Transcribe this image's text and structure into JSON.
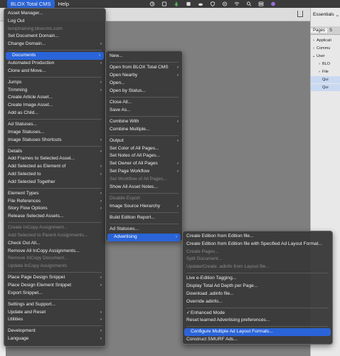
{
  "menubar": {
    "items": [
      "BLOX Total CMS",
      "Help"
    ]
  },
  "panel": {
    "workspace": "Essentials",
    "tabs": [
      "Pages",
      "S"
    ],
    "tree": [
      "Applicati",
      "Commu",
      "User",
      "BLO",
      "File",
      "Qui",
      "Qui"
    ]
  },
  "main_menu": [
    {
      "label": "Asset Manager...",
      "disabled": false
    },
    {
      "label": "Log Out",
      "disabled": false
    },
    {
      "label": "temptraining.bloxcms.com",
      "disabled": true
    },
    {
      "label": "Set Document Domain...",
      "disabled": false
    },
    {
      "label": "Change Domain...",
      "disabled": false,
      "submenu": true
    },
    {
      "sep": true
    },
    {
      "label": "Documents",
      "disabled": false,
      "submenu": true,
      "highlighted": true
    },
    {
      "label": "Automated Production",
      "disabled": false,
      "submenu": true
    },
    {
      "label": "Clone and Move...",
      "disabled": false
    },
    {
      "sep": true
    },
    {
      "label": "Jumps",
      "disabled": false,
      "submenu": true
    },
    {
      "label": "Trimming",
      "disabled": false,
      "submenu": true
    },
    {
      "label": "Create Article Asset...",
      "disabled": false
    },
    {
      "label": "Create Image Asset...",
      "disabled": false
    },
    {
      "label": "Add as Child...",
      "disabled": false
    },
    {
      "sep": true
    },
    {
      "label": "Ad Statuses...",
      "disabled": false
    },
    {
      "label": "Image Statuses...",
      "disabled": false
    },
    {
      "label": "Image Statuses Shortcuts",
      "disabled": false,
      "submenu": true
    },
    {
      "sep": true
    },
    {
      "label": "Details",
      "disabled": false,
      "submenu": true
    },
    {
      "label": "Add Frames to Selected Asset...",
      "disabled": false
    },
    {
      "label": "Add Selected as Element of",
      "disabled": false,
      "submenu": true
    },
    {
      "label": "Add Selected to",
      "disabled": false,
      "submenu": true
    },
    {
      "label": "Add Selected Together",
      "disabled": false
    },
    {
      "sep": true
    },
    {
      "label": "Element Types",
      "disabled": false,
      "submenu": true
    },
    {
      "label": "File References",
      "disabled": false,
      "submenu": true
    },
    {
      "label": "Story Flow Options",
      "disabled": false,
      "submenu": true
    },
    {
      "label": "Release Selected Assets...",
      "disabled": false
    },
    {
      "sep": true
    },
    {
      "label": "Create InCopy Assignment...",
      "disabled": true
    },
    {
      "label": "Add Selected to Parent Assignments...",
      "disabled": true
    },
    {
      "label": "Check Out All...",
      "disabled": false
    },
    {
      "label": "Remove All InCopy Assignments...",
      "disabled": false
    },
    {
      "label": "Remove InCopy Document...",
      "disabled": true
    },
    {
      "label": "Update InCopy Assignments",
      "disabled": true
    },
    {
      "sep": true
    },
    {
      "label": "Place Page Design Snippet",
      "disabled": false,
      "submenu": true
    },
    {
      "label": "Place Design Element Snippet",
      "disabled": false,
      "submenu": true
    },
    {
      "label": "Export Snippet...",
      "disabled": false
    },
    {
      "sep": true
    },
    {
      "label": "Settings and Support...",
      "disabled": false
    },
    {
      "label": "Update and Reset",
      "disabled": false,
      "submenu": true
    },
    {
      "label": "Utilities",
      "disabled": false,
      "submenu": true
    },
    {
      "sep": true
    },
    {
      "label": "Development",
      "disabled": false,
      "submenu": true
    },
    {
      "label": "Language",
      "disabled": false,
      "submenu": true
    }
  ],
  "documents_menu": [
    {
      "label": "New...",
      "disabled": false
    },
    {
      "sep": true
    },
    {
      "label": "Open from BLOX Total CMS",
      "disabled": false,
      "submenu": true
    },
    {
      "label": "Open Nearby",
      "disabled": false,
      "submenu": true
    },
    {
      "label": "Open...",
      "disabled": false
    },
    {
      "label": "Open by Status...",
      "disabled": false
    },
    {
      "sep": true
    },
    {
      "label": "Close All...",
      "disabled": false
    },
    {
      "label": "Save As...",
      "disabled": false
    },
    {
      "sep": true
    },
    {
      "label": "Combine With",
      "disabled": false,
      "submenu": true
    },
    {
      "label": "Combine Multiple...",
      "disabled": false
    },
    {
      "sep": true
    },
    {
      "label": "Output",
      "disabled": false,
      "submenu": true
    },
    {
      "label": "Set Color of All Pages...",
      "disabled": false
    },
    {
      "label": "Set Notes of All Pages...",
      "disabled": false
    },
    {
      "label": "Set Owner of All Pages",
      "disabled": false,
      "submenu": true
    },
    {
      "label": "Set Page Workflow",
      "disabled": false,
      "submenu": true
    },
    {
      "label": "Set Workflow of All Pages...",
      "disabled": true
    },
    {
      "label": "Show All Asset Notes...",
      "disabled": false
    },
    {
      "sep": true
    },
    {
      "label": "Disable Export",
      "disabled": true
    },
    {
      "label": "Image Source Hierarchy",
      "disabled": false,
      "submenu": true
    },
    {
      "sep": true
    },
    {
      "label": "Build Edition Report...",
      "disabled": false
    },
    {
      "sep": true
    },
    {
      "label": "Ad Statuses...",
      "disabled": false
    },
    {
      "label": "Advertising",
      "disabled": false,
      "submenu": true,
      "highlighted": true
    }
  ],
  "advertising_menu": [
    {
      "label": "Create Edition from Edition file...",
      "disabled": false
    },
    {
      "label": "Create Edition from Edition file with Specified Ad Layout Format...",
      "disabled": false
    },
    {
      "label": "Create Pages...",
      "disabled": true
    },
    {
      "label": "Split Document...",
      "disabled": true
    },
    {
      "label": "Update/Create .adinfo from Layout file...",
      "disabled": true
    },
    {
      "sep": true
    },
    {
      "label": "Live e-Edition Tagging...",
      "disabled": false
    },
    {
      "label": "Display Total Ad Depth per Page...",
      "disabled": false
    },
    {
      "label": "Download .adinfo file...",
      "disabled": false
    },
    {
      "label": "Override adinfo...",
      "disabled": false
    },
    {
      "sep": true
    },
    {
      "label": "Enhanced Mode",
      "disabled": false,
      "checked": true
    },
    {
      "label": "Reset learned Advertising preferences...",
      "disabled": false
    },
    {
      "sep": true
    },
    {
      "label": "Configure Multiple Ad Layout Formats...",
      "disabled": false,
      "highlighted": true
    },
    {
      "label": "Construct SMURF Ads...",
      "disabled": false
    }
  ]
}
